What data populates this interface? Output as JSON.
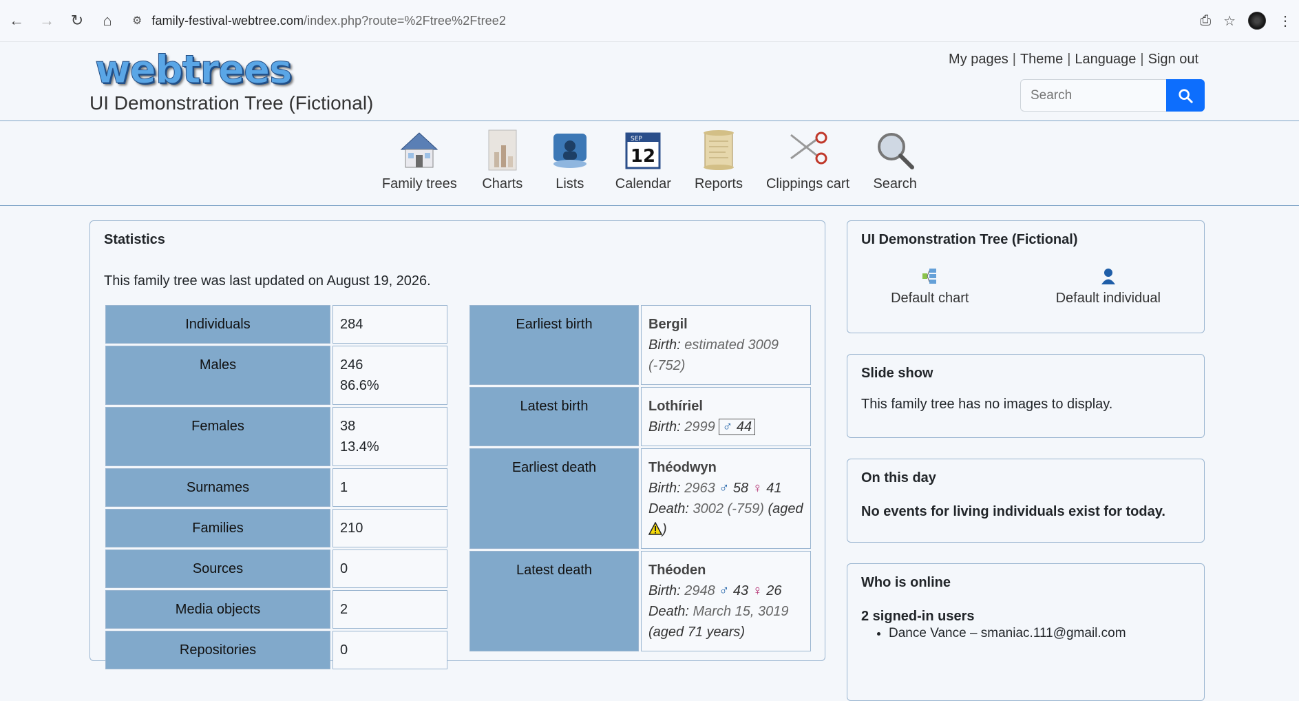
{
  "browser": {
    "url_domain": "family-festival-webtree.com",
    "url_path": "/index.php?route=%2Ftree%2Ftree2"
  },
  "header": {
    "logo_text": "webtrees",
    "tree_title": "UI Demonstration Tree (Fictional)",
    "links": [
      "My pages",
      "Theme",
      "Language",
      "Sign out"
    ],
    "search_placeholder": "Search"
  },
  "nav": {
    "items": [
      {
        "label": "Family trees",
        "icon": "house-icon"
      },
      {
        "label": "Charts",
        "icon": "chart-icon"
      },
      {
        "label": "Lists",
        "icon": "lists-icon"
      },
      {
        "label": "Calendar",
        "icon": "calendar-icon"
      },
      {
        "label": "Reports",
        "icon": "scroll-icon"
      },
      {
        "label": "Clippings cart",
        "icon": "scissors-icon"
      },
      {
        "label": "Search",
        "icon": "magnifier-icon"
      }
    ],
    "calendar_month": "SEP",
    "calendar_day": "12"
  },
  "stats": {
    "title": "Statistics",
    "updated": "This family tree was last updated on August 19, 2026.",
    "rows": [
      {
        "label": "Individuals",
        "value": "284",
        "sub": ""
      },
      {
        "label": "Males",
        "value": "246",
        "sub": "86.6%"
      },
      {
        "label": "Females",
        "value": "38",
        "sub": "13.4%"
      },
      {
        "label": "Surnames",
        "value": "1",
        "sub": ""
      },
      {
        "label": "Families",
        "value": "210",
        "sub": ""
      },
      {
        "label": "Sources",
        "value": "0",
        "sub": ""
      },
      {
        "label": "Media objects",
        "value": "2",
        "sub": ""
      },
      {
        "label": "Repositories",
        "value": "0",
        "sub": ""
      }
    ],
    "earliest_birth": {
      "label": "Earliest birth",
      "name": "Bergil",
      "birth_label": "Birth:",
      "birth_date": "estimated 3009",
      "birth_extra": "(-752)"
    },
    "latest_birth": {
      "label": "Latest birth",
      "name": "Lothíriel",
      "birth_label": "Birth:",
      "birth_date": "2999",
      "father_age": "44"
    },
    "earliest_death": {
      "label": "Earliest death",
      "name": "Théodwyn",
      "birth_label": "Birth:",
      "birth_date": "2963",
      "father_age": "58",
      "mother_age": "41",
      "death_label": "Death:",
      "death_date": "3002 (-759)",
      "aged_open": "(aged",
      "aged_close": ")"
    },
    "latest_death": {
      "label": "Latest death",
      "name": "Théoden",
      "birth_label": "Birth:",
      "birth_date": "2948",
      "father_age": "43",
      "mother_age": "26",
      "death_label": "Death:",
      "death_date": "March 15, 3019",
      "aged": "(aged 71 years)"
    }
  },
  "sidebar": {
    "tree_title": "UI Demonstration Tree (Fictional)",
    "default_chart": "Default chart",
    "default_individual": "Default individual",
    "slideshow_title": "Slide show",
    "slideshow_text": "This family tree has no images to display.",
    "onthisday_title": "On this day",
    "onthisday_text": "No events for living individuals exist for today.",
    "online_title": "Who is online",
    "online_count": "2 signed-in users",
    "online_users": [
      "Dance Vance – smaniac.111@gmail.com"
    ]
  },
  "symbols": {
    "male": "♂",
    "female": "♀",
    "sep": "|"
  }
}
